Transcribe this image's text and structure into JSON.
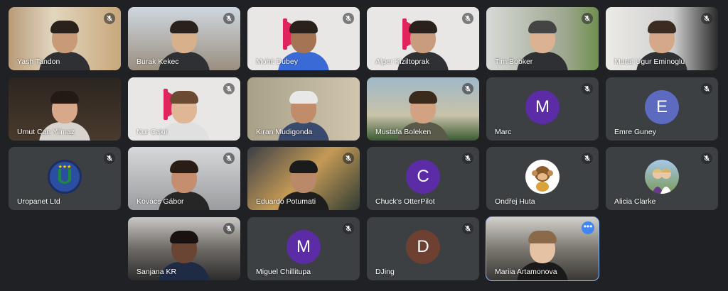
{
  "participants": [
    {
      "name": "Yash Tandon",
      "muted": true
    },
    {
      "name": "Burak Kekec",
      "muted": true
    },
    {
      "name": "Mohit Dubey",
      "muted": true
    },
    {
      "name": "Alper Kiziltoprak",
      "muted": true
    },
    {
      "name": "Tim Bobker",
      "muted": true
    },
    {
      "name": "Murat Ugur Eminoglu",
      "muted": true
    },
    {
      "name": "Umut Can Yilmaz",
      "muted": false
    },
    {
      "name": "Nur Cakir",
      "muted": true
    },
    {
      "name": "Kiran Mudigonda",
      "muted": false
    },
    {
      "name": "Mustafa Boleken",
      "muted": true
    },
    {
      "name": "Marc",
      "muted": true,
      "avatar_letter": "M"
    },
    {
      "name": "Emre Guney",
      "muted": true,
      "avatar_letter": "E"
    },
    {
      "name": "Uropanet Ltd",
      "muted": true
    },
    {
      "name": "Kovács Gábor",
      "muted": true
    },
    {
      "name": "Eduardo Potumati",
      "muted": true
    },
    {
      "name": "Chuck's OtterPilot",
      "muted": true,
      "avatar_letter": "C"
    },
    {
      "name": "Ondřej Huta",
      "muted": true
    },
    {
      "name": "Alicia Clarke",
      "muted": true
    },
    {
      "name": "Sanjana KR",
      "muted": true
    },
    {
      "name": "Miguel Chillitupa",
      "muted": true,
      "avatar_letter": "M"
    },
    {
      "name": "DJing",
      "muted": true,
      "avatar_letter": "D"
    },
    {
      "name": "Mariia Artamonova",
      "muted": false
    }
  ],
  "colors": {
    "background": "#202124",
    "tile": "#3c4043",
    "active_outline": "#8ab4f8",
    "avatar_purple": "#5b2ca5",
    "avatar_blue": "#5c6bc0",
    "avatar_brown": "#6d4031",
    "brand_red": "#e0245e"
  },
  "more_options_icon": "more-horiz-icon",
  "mic_icon": "mic-off-icon"
}
